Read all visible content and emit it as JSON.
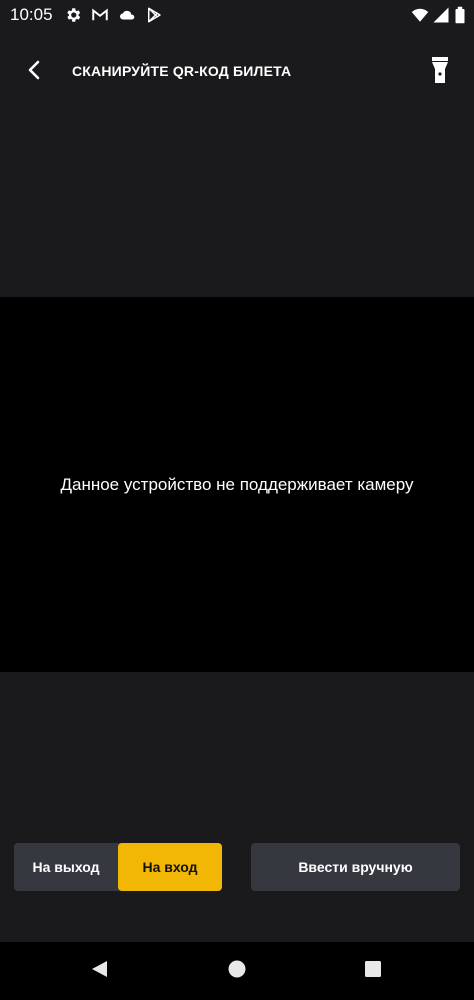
{
  "status_bar": {
    "time": "10:05",
    "left_icons": [
      "gear-icon",
      "gmail-icon",
      "cloud-icon",
      "play-store-icon"
    ],
    "right_icons": [
      "wifi-icon",
      "signal-icon",
      "battery-icon"
    ]
  },
  "app_bar": {
    "title": "СКАНИРУЙТЕ QR-КОД БИЛЕТА",
    "back_icon": "chevron-left-icon",
    "flashlight_icon": "flashlight-icon"
  },
  "camera": {
    "message": "Данное устройство не поддерживает камеру"
  },
  "mode_toggle": {
    "exit_label": "На выход",
    "enter_label": "На вход",
    "selected": "enter"
  },
  "manual_entry": {
    "label": "Ввести вручную"
  },
  "nav_bar": {
    "icons": [
      "back-triangle-icon",
      "home-circle-icon",
      "recents-square-icon"
    ]
  },
  "colors": {
    "background": "#1a191b",
    "camera_background": "#000000",
    "button_background": "#363840",
    "accent": "#f2b705"
  }
}
